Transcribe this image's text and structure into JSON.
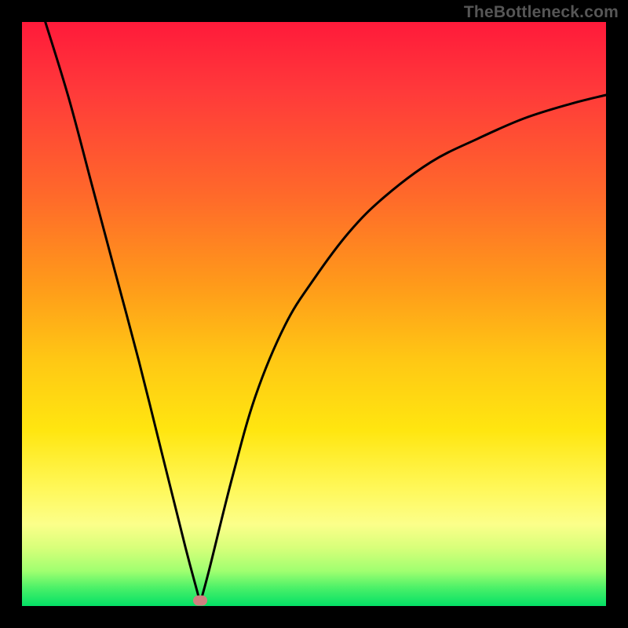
{
  "watermark": "TheBottleneck.com",
  "chart_data": {
    "type": "line",
    "title": "",
    "xlabel": "",
    "ylabel": "",
    "xlim": [
      0,
      1
    ],
    "ylim": [
      0,
      1
    ],
    "background_gradient": {
      "direction": "vertical",
      "stops": [
        {
          "pos": 0.0,
          "color": "#ff1a3a"
        },
        {
          "pos": 0.3,
          "color": "#ff6a2a"
        },
        {
          "pos": 0.58,
          "color": "#ffc814"
        },
        {
          "pos": 0.8,
          "color": "#fff85a"
        },
        {
          "pos": 0.94,
          "color": "#a0ff70"
        },
        {
          "pos": 1.0,
          "color": "#04e066"
        }
      ]
    },
    "series": [
      {
        "name": "bottleneck-curve",
        "note": "y is fraction from bottom (0=bottom, 1=top); sharp cusp near x≈0.305",
        "x": [
          0.04,
          0.08,
          0.12,
          0.16,
          0.2,
          0.24,
          0.28,
          0.3,
          0.305,
          0.32,
          0.36,
          0.4,
          0.45,
          0.5,
          0.56,
          0.62,
          0.7,
          0.78,
          0.86,
          0.94,
          1.0
        ],
        "y": [
          1.0,
          0.87,
          0.72,
          0.57,
          0.42,
          0.26,
          0.1,
          0.025,
          0.005,
          0.06,
          0.22,
          0.36,
          0.48,
          0.56,
          0.64,
          0.7,
          0.76,
          0.8,
          0.835,
          0.86,
          0.875
        ]
      }
    ],
    "marker": {
      "x": 0.305,
      "y": 0.01,
      "color": "#d08080"
    },
    "frame": {
      "outer_size_px": 800,
      "inner_size_px": 744,
      "border_px": 28,
      "border_color": "#000000"
    }
  }
}
